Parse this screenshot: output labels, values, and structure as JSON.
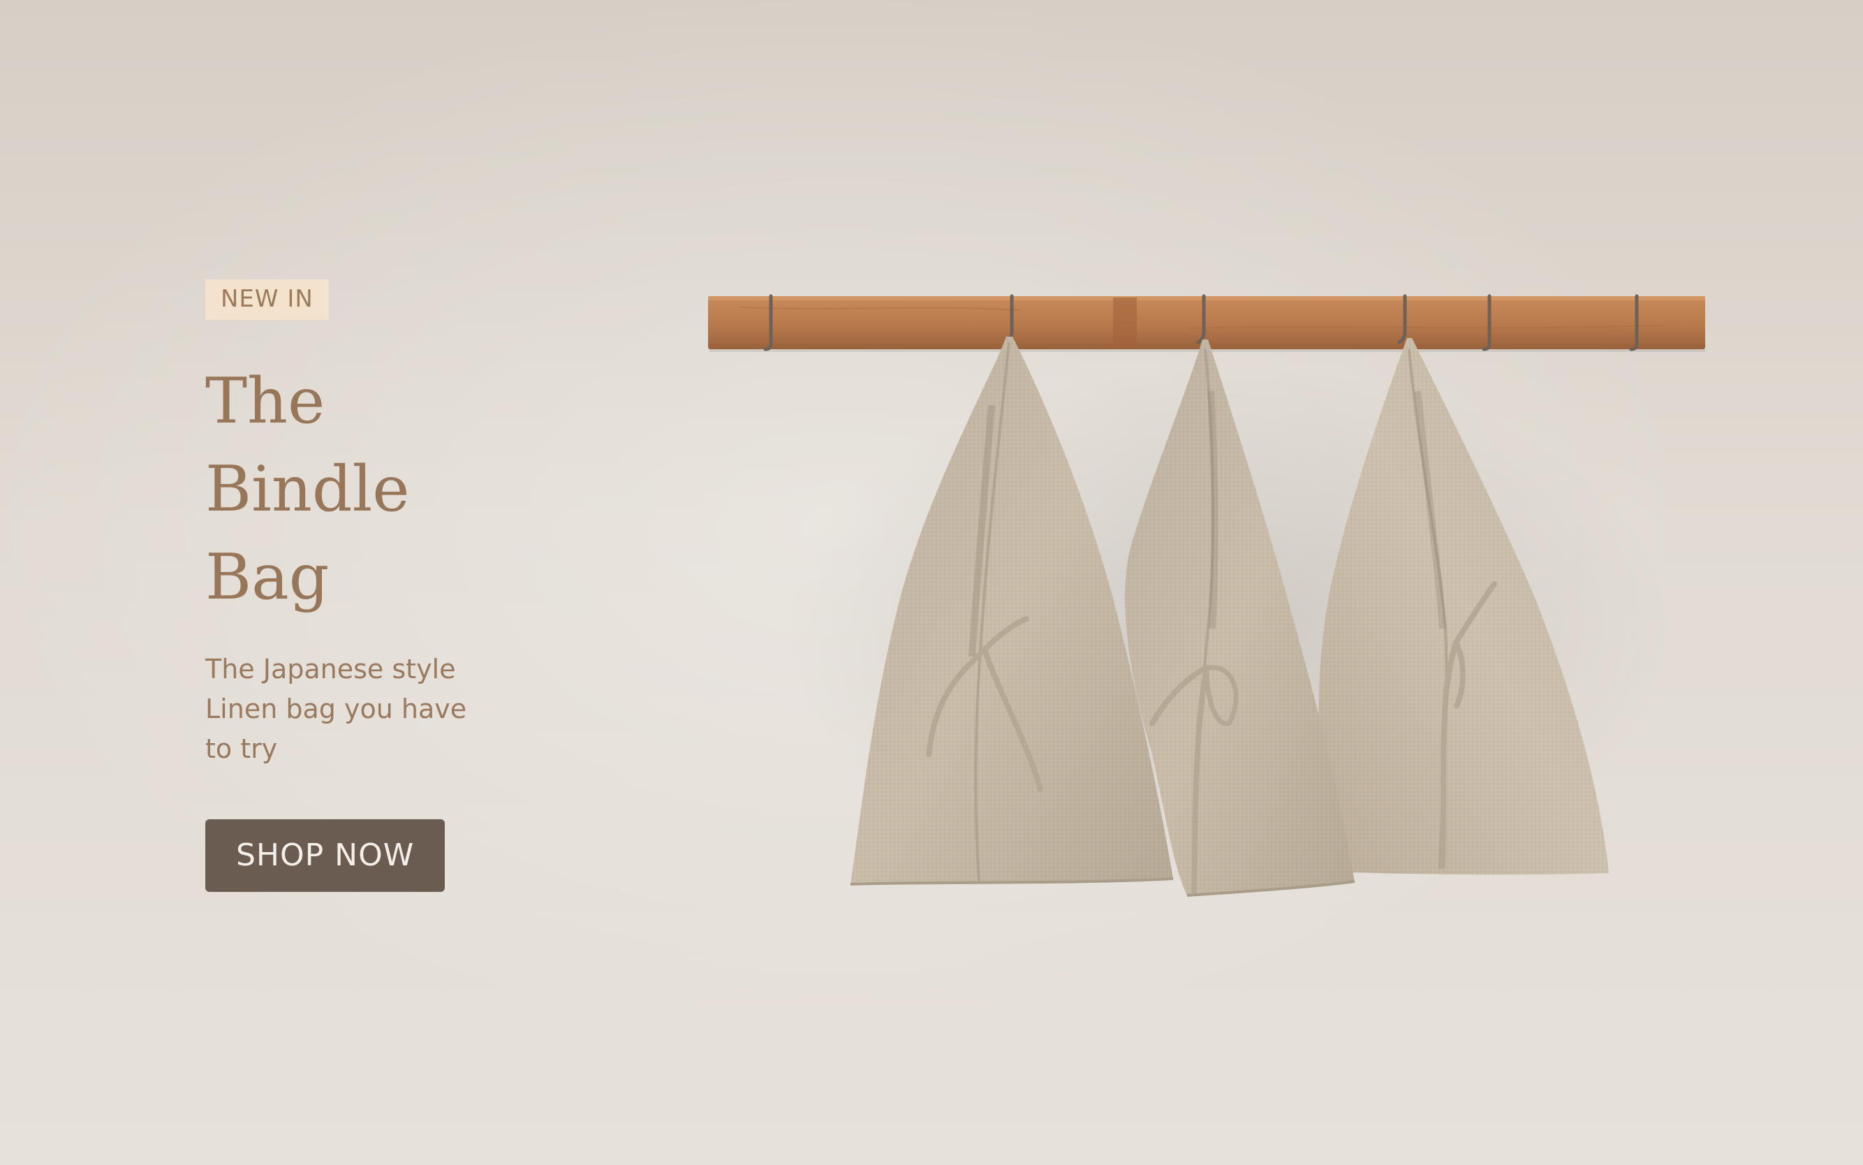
{
  "hero": {
    "badge": "NEW IN",
    "title_lines": [
      "The",
      "Bindle",
      "Bag"
    ],
    "subtitle_lines": [
      "The Japanese style",
      "Linen bag you have",
      "to try"
    ],
    "cta_label": "SHOP NOW"
  },
  "colors": {
    "background": "#dcd6cd",
    "badge_bg": "#f3e3cc",
    "text_accent": "#97765a",
    "cta_bg": "#6b5c52",
    "cta_text": "#f4efe9",
    "rack_wood": "#b87a4d",
    "linen": "#c7bba8"
  },
  "image": {
    "subject": "three-linen-bags-on-wooden-hook-rack"
  }
}
